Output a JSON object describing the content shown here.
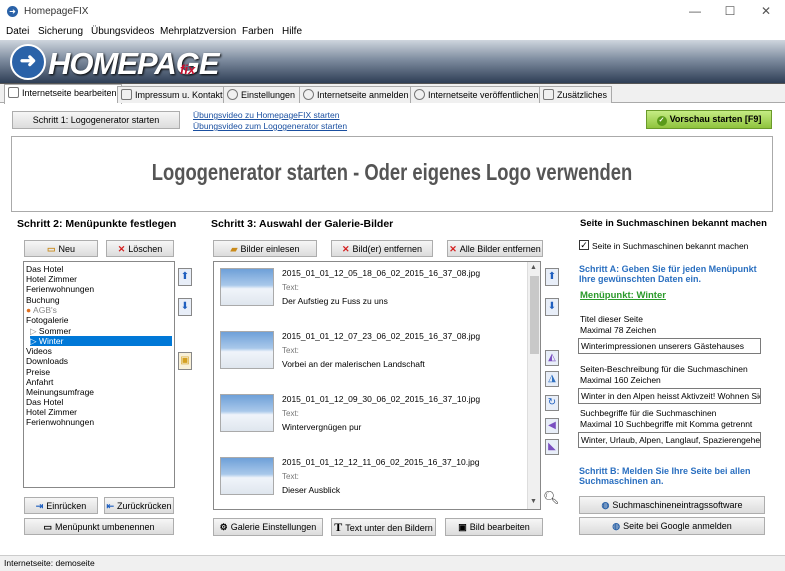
{
  "window": {
    "title": "HomepageFIX",
    "minimize": "—",
    "maximize": "☐",
    "close": "✕"
  },
  "menu": [
    "Datei",
    "Sicherung",
    "Übungsvideos",
    "Mehrplatzversion",
    "Farben",
    "Hilfe"
  ],
  "banner": {
    "logo": "HOMEPAGE",
    "logo_suffix": "fix"
  },
  "tabs": [
    "Internetseite bearbeiten",
    "Impressum u. Kontakt",
    "Einstellungen",
    "Internetseite anmelden",
    "Internetseite veröffentlichen",
    "Zusätzliches"
  ],
  "toolbar": {
    "step1_button": "Schritt 1: Logogenerator starten",
    "video_link_1": "Übungsvideo zu HomepageFIX starten",
    "video_link_2": "Übungsvideo zum Logogenerator starten",
    "preview_button": "Vorschau starten [F9]",
    "preview_color": "#9bd04a"
  },
  "logo_area": {
    "text": "Logogenerator starten - Oder eigenes Logo verwenden"
  },
  "step2": {
    "title": "Schritt 2: Menüpunkte festlegen",
    "new_button": "Neu",
    "delete_button": "Löschen",
    "items": [
      {
        "label": "Das Hotel"
      },
      {
        "label": "Hotel Zimmer"
      },
      {
        "label": "Ferienwohnungen"
      },
      {
        "label": "Buchung"
      },
      {
        "label": "AGB's"
      },
      {
        "label": "Fotogalerie"
      },
      {
        "label": "Sommer"
      },
      {
        "label": "Winter"
      },
      {
        "label": "Videos"
      },
      {
        "label": "Downloads"
      },
      {
        "label": "Preise"
      },
      {
        "label": "Anfahrt"
      },
      {
        "label": "Meinungsumfrage"
      },
      {
        "label": "Das Hotel"
      },
      {
        "label": "Hotel Zimmer"
      },
      {
        "label": "Ferienwohnungen"
      }
    ],
    "indent_button": "Einrücken",
    "outdent_button": "Zurückrücken",
    "rename_button": "Menüpunkt umbenennen"
  },
  "step3": {
    "title": "Schritt 3: Auswahl der Galerie-Bilder",
    "load_button": "Bilder einlesen",
    "remove_button": "Bild(er) entfernen",
    "remove_all_button": "Alle Bilder entfernen",
    "text_label": "Text:",
    "images": [
      {
        "file": "2015_01_01_12_05_18_06_02_2015_16_37_08.jpg",
        "text": "Der Aufstieg zu Fuss zu uns"
      },
      {
        "file": "2015_01_01_12_07_23_06_02_2015_16_37_08.jpg",
        "text": "Vorbei an der malerischen Landschaft"
      },
      {
        "file": "2015_01_01_12_09_30_06_02_2015_16_37_10.jpg",
        "text": "Wintervergnügen pur"
      },
      {
        "file": "2015_01_01_12_12_11_06_02_2015_16_37_10.jpg",
        "text": "Dieser Ausblick"
      }
    ],
    "gallery_settings_button": "Galerie Einstellungen",
    "text_under_images_button": "Text unter den Bildern",
    "edit_image_button": "Bild bearbeiten"
  },
  "seo": {
    "title": "Seite in Suchmaschinen bekannt machen",
    "checkbox_label": "Seite in Suchmaschinen bekannt machen",
    "step_a": "Schritt A: Geben Sie für jeden Menüpunkt Ihre gewünschten Daten ein.",
    "current_item": "Menüpunkt: Winter",
    "page_title_label": "Titel dieser Seite",
    "page_title_max": "Maximal 78 Zeichen",
    "page_title_value": "Winterimpressionen unserers Gästehauses",
    "description_label": "Seiten-Beschreibung für die Suchmaschinen",
    "description_max": "Maximal 160 Zeichen",
    "description_value": "Winter in den Alpen heisst Aktivzeit! Wohnen Sie",
    "keywords_label": "Suchbegriffe für die Suchmaschinen",
    "keywords_max": "Maximal 10 Suchbegriffe mit Komma getrennt",
    "keywords_value": "Winter, Urlaub, Alpen, Langlauf, Spazierengeher",
    "step_b": "Schritt B: Melden Sie Ihre Seite bei allen Suchmaschinen an.",
    "submit_button": "Suchmaschineneintragssoftware",
    "google_button": "Seite bei Google anmelden"
  },
  "status": {
    "text": "Internetseite: demoseite"
  }
}
